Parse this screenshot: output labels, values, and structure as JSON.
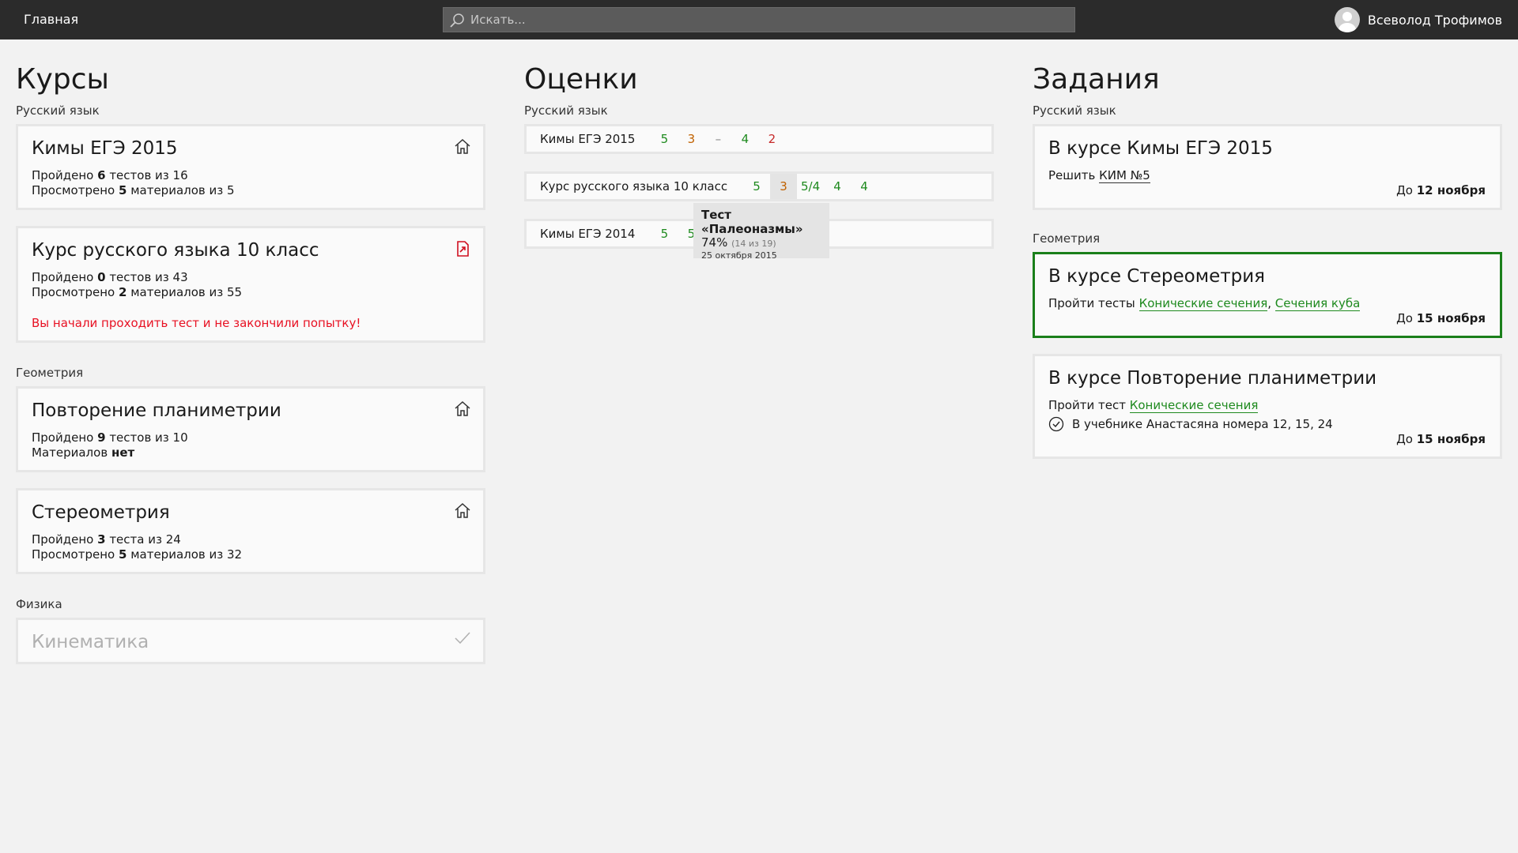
{
  "topbar": {
    "home_label": "Главная",
    "search_placeholder": "Искать...",
    "user_name": "Всеволод Трофимов"
  },
  "courses": {
    "title": "Курсы",
    "groups": [
      {
        "label": "Русский язык",
        "items": [
          {
            "title": "Кимы ЕГЭ 2015",
            "tests_prefix": "Пройдено",
            "tests_done": "6",
            "tests_suffix": "тестов из 16",
            "mat_prefix": "Просмотрено",
            "mat_done": "5",
            "mat_suffix": "материалов из 5",
            "icon": "home-icon"
          },
          {
            "title": "Курс русского языка 10 класс",
            "tests_prefix": "Пройдено",
            "tests_done": "0",
            "tests_suffix": "тестов из 43",
            "mat_prefix": "Просмотрено",
            "mat_done": "2",
            "mat_suffix": "материалов из 55",
            "warning": "Вы начали проходить тест и не закончили попытку!",
            "icon": "document-alert-icon"
          }
        ]
      },
      {
        "label": "Геометрия",
        "items": [
          {
            "title": "Повторение планиметрии",
            "tests_prefix": "Пройдено",
            "tests_done": "9",
            "tests_suffix": "тестов из 10",
            "mat_prefix": "Материалов",
            "mat_done": "нет",
            "icon": "home-icon"
          },
          {
            "title": "Стереометрия",
            "tests_prefix": "Пройдено",
            "tests_done": "3",
            "tests_suffix": "теста из 24",
            "mat_prefix": "Просмотрено",
            "mat_done": "5",
            "mat_suffix": "материалов из 32",
            "icon": "home-icon"
          }
        ]
      },
      {
        "label": "Физика",
        "items": [
          {
            "title": "Кинематика",
            "icon": "checkmark-icon"
          }
        ]
      }
    ]
  },
  "grades": {
    "title": "Оценки",
    "group_label": "Русский язык",
    "rows": [
      {
        "name": "Кимы ЕГЭ 2015",
        "grades": [
          "5",
          "3",
          "–",
          "4",
          "2"
        ]
      },
      {
        "name": "Курс русского языка 10 класс",
        "grades": [
          "5",
          "3",
          "5/4",
          "4",
          "4"
        ]
      },
      {
        "name": "Кимы ЕГЭ 2014",
        "grades": [
          "5",
          "5"
        ]
      }
    ],
    "tooltip": {
      "title": "Тест «Палеоназмы»",
      "percent": "74%",
      "detail": "(14 из 19)",
      "date": "25 октября 2015"
    }
  },
  "tasks": {
    "title": "Задания",
    "groups": [
      {
        "label": "Русский язык",
        "items": [
          {
            "title": "В курсе Кимы ЕГЭ 2015",
            "action": "Решить",
            "links": [
              "КИМ №5"
            ],
            "due_prefix": "До",
            "due_date": "12 ноября"
          }
        ]
      },
      {
        "label": "Геометрия",
        "items": [
          {
            "title": "В курсе Стереометрия",
            "action": "Пройти тесты",
            "links": [
              "Конические сечения",
              "Сечения куба"
            ],
            "due_prefix": "До",
            "due_date": "15 ноября"
          },
          {
            "title": "В курсе Повторение планиметрии",
            "action": "Пройти тест",
            "links": [
              "Конические сечения"
            ],
            "check": "В учебнике Анастасяна номера 12, 15, 24",
            "due_prefix": "До",
            "due_date": "15 ноября"
          }
        ]
      }
    ]
  },
  "colors": {
    "accent_green": "#1e8a1e",
    "warning_red": "#e81123",
    "topbar": "#2b2b2b"
  }
}
